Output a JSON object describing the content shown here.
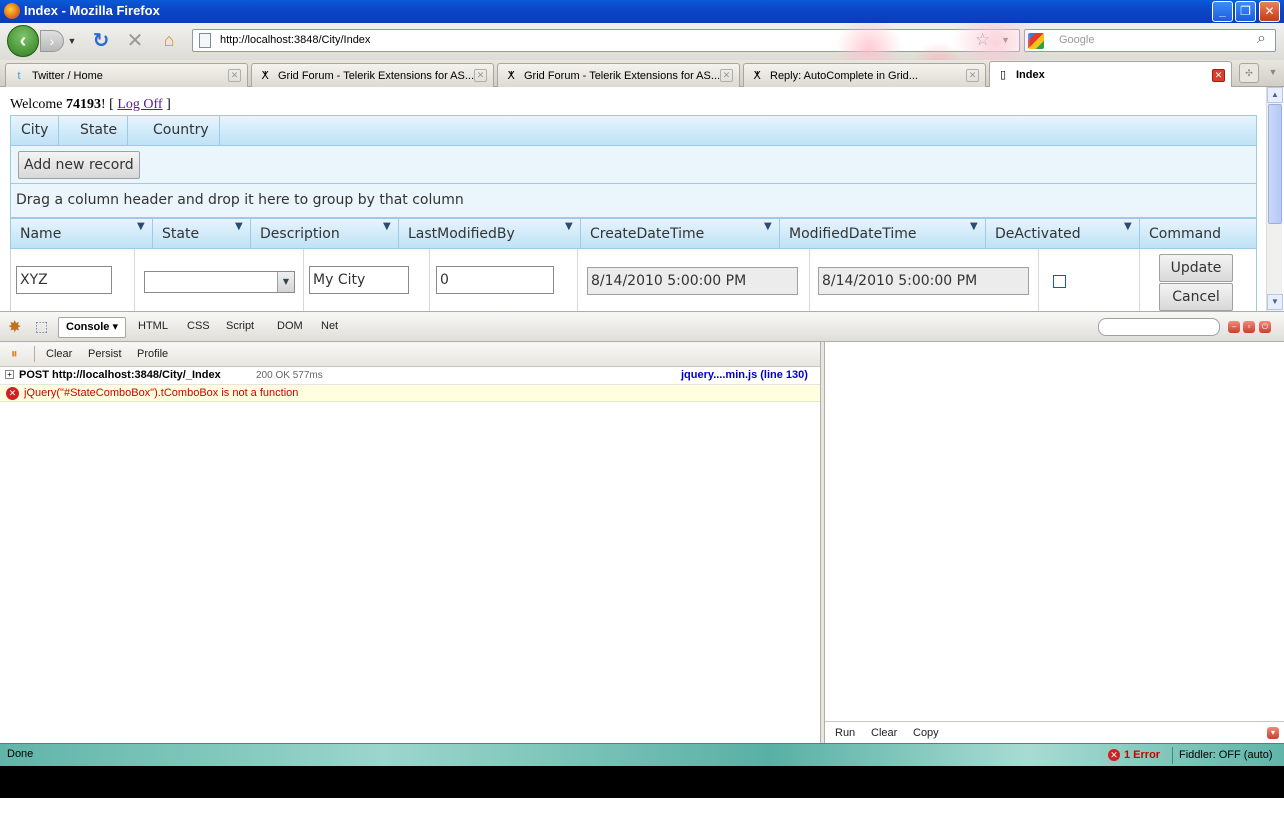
{
  "window": {
    "title": "Index - Mozilla Firefox",
    "minimize": "_",
    "maximize": "❐",
    "close": "✕"
  },
  "navbar": {
    "url": "http://localhost:3848/City/Index",
    "search_placeholder": "Google"
  },
  "tabs": [
    {
      "label": "Twitter / Home",
      "icon": "twitter-icon"
    },
    {
      "label": "Grid Forum - Telerik Extensions for AS...",
      "icon": "telerik-icon"
    },
    {
      "label": "Grid Forum - Telerik Extensions for AS...",
      "icon": "telerik-icon"
    },
    {
      "label": "Reply: AutoComplete in Grid...",
      "icon": "telerik-icon"
    },
    {
      "label": "Index",
      "icon": "page-icon",
      "active": true
    }
  ],
  "page": {
    "welcome_prefix": "Welcome ",
    "username": "74193",
    "welcome_mid": "! [ ",
    "logoff": "Log Off",
    "welcome_suffix": " ]",
    "menu": [
      "City",
      "State",
      "Country"
    ],
    "add_button": "Add new record",
    "group_hint": "Drag a column header and drop it here to group by that column",
    "columns": [
      "Name",
      "State",
      "Description",
      "LastModifiedBy",
      "CreateDateTime",
      "ModifiedDateTime",
      "DeActivated",
      "Command"
    ],
    "row": {
      "name": "XYZ",
      "state": "",
      "description": "My City",
      "last_modified_by": "0",
      "create_date_time": "8/14/2010 5:00:00 PM",
      "modified_date_time": "8/14/2010 5:00:00 PM",
      "deactivated": false
    },
    "update_button": "Update",
    "cancel_button": "Cancel"
  },
  "firebug": {
    "tabs": [
      "Console ▾",
      "HTML",
      "CSS",
      "Script",
      "DOM",
      "Net"
    ],
    "sub": [
      "Clear",
      "Persist",
      "Profile"
    ],
    "post_line": {
      "method": "POST",
      "url": "http://localhost:3848/City/_Index",
      "status": "200 OK 577ms",
      "source": "jquery....min.js (line 130)"
    },
    "error_line": "jQuery(\"#StateComboBox\").tComboBox is not a function",
    "cmd": [
      "Run",
      "Clear",
      "Copy"
    ]
  },
  "status": {
    "text": "Done",
    "errors": "1 Error",
    "fiddler": "Fiddler: OFF (auto)"
  },
  "colors": {
    "grid_header": "#bfe2f6",
    "error": "#cc0000",
    "status_bar": "#5fb5a8"
  }
}
